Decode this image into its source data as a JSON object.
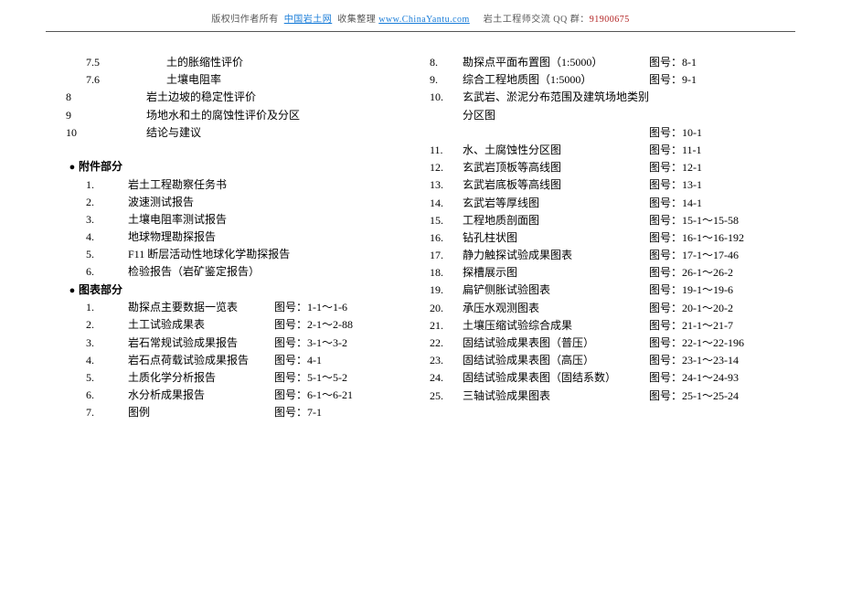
{
  "header": {
    "copyright": "版权归作者所有",
    "site_name": "中国岩土网",
    "collect": "收集整理",
    "site_url": "www.ChinaYantu.com",
    "group_prefix": "岩土工程师交流 QQ 群：",
    "group_number": "91900675"
  },
  "left": {
    "initial": [
      {
        "lead": "7.5",
        "title": "土的胀缩性评价",
        "leadClass": "deep"
      },
      {
        "lead": "7.6",
        "title": "土壤电阻率",
        "leadClass": "deep"
      },
      {
        "lead": "8",
        "title": "岩土边坡的稳定性评价",
        "leadClass": ""
      },
      {
        "lead": "9",
        "title": "场地水和土的腐蚀性评价及分区",
        "leadClass": ""
      },
      {
        "lead": "10",
        "title": "结论与建议",
        "leadClass": ""
      }
    ],
    "attach_heading": "附件部分",
    "attachments": [
      {
        "lead": "1.",
        "title": "岩土工程勘察任务书"
      },
      {
        "lead": "2.",
        "title": "波速测试报告"
      },
      {
        "lead": "3.",
        "title": "土壤电阻率测试报告"
      },
      {
        "lead": "4.",
        "title": "地球物理勘探报告"
      },
      {
        "lead": "5.",
        "title": "F11 断层活动性地球化学勘探报告"
      },
      {
        "lead": "6.",
        "title": "检验报告（岩矿鉴定报告）"
      }
    ],
    "charts_heading": "图表部分",
    "charts": [
      {
        "lead": "1.",
        "title": "勘探点主要数据一览表",
        "fig": "图号：1-1～1-6"
      },
      {
        "lead": "2.",
        "title": "土工试验成果表",
        "fig": "图号：2-1～2-88"
      },
      {
        "lead": "3.",
        "title": "岩石常规试验成果报告",
        "fig": "图号：3-1～3-2"
      },
      {
        "lead": "4.",
        "title": "岩石点荷载试验成果报告",
        "fig": "图号：4-1"
      },
      {
        "lead": "5.",
        "title": "土质化学分析报告",
        "fig": "图号：5-1～5-2"
      },
      {
        "lead": "6.",
        "title": "水分析成果报告",
        "fig": "图号：6-1～6-21"
      },
      {
        "lead": "7.",
        "title": "图例",
        "fig": "图号：7-1"
      }
    ]
  },
  "right": {
    "items": [
      {
        "lead": "8.",
        "title": "勘探点平面布置图（1:5000）",
        "fig": "图号：8-1"
      },
      {
        "lead": "9.",
        "title": "综合工程地质图（1:5000）",
        "fig": "图号：9-1"
      },
      {
        "lead": "10.",
        "title": "玄武岩、淤泥分布范围及建筑场地类别分区图",
        "fig": ""
      },
      {
        "lead": "",
        "title": "",
        "fig": "图号：10-1"
      },
      {
        "lead": "11.",
        "title": "水、土腐蚀性分区图",
        "fig": "图号：11-1"
      },
      {
        "lead": "12.",
        "title": "玄武岩顶板等高线图",
        "fig": "图号：12-1"
      },
      {
        "lead": "13.",
        "title": "玄武岩底板等高线图",
        "fig": "图号：13-1"
      },
      {
        "lead": "14.",
        "title": "玄武岩等厚线图",
        "fig": "图号：14-1"
      },
      {
        "lead": "15.",
        "title": "工程地质剖面图",
        "fig": "图号：15-1～15-58"
      },
      {
        "lead": "16.",
        "title": "钻孔柱状图",
        "fig": "图号：16-1～16-192"
      },
      {
        "lead": "17.",
        "title": "静力触探试验成果图表",
        "fig": "图号：17-1～17-46"
      },
      {
        "lead": "18.",
        "title": "探槽展示图",
        "fig": "图号：26-1～26-2"
      },
      {
        "lead": "19.",
        "title": "扁铲侧胀试验图表",
        "fig": "图号：19-1～19-6"
      },
      {
        "lead": "20.",
        "title": "承压水观测图表",
        "fig": "图号：20-1～20-2"
      },
      {
        "lead": "21.",
        "title": "土壤压缩试验综合成果",
        "fig": "图号：21-1～21-7"
      },
      {
        "lead": "22.",
        "title": "固结试验成果表图（普压）",
        "fig": "图号：22-1～22-196"
      },
      {
        "lead": "23.",
        "title": "固结试验成果表图（高压）",
        "fig": "图号：23-1～23-14"
      },
      {
        "lead": "24.",
        "title": "固结试验成果表图（固结系数）",
        "fig": "图号：24-1～24-93"
      },
      {
        "lead": "25.",
        "title": "三轴试验成果图表",
        "fig": "图号：25-1～25-24"
      }
    ]
  }
}
